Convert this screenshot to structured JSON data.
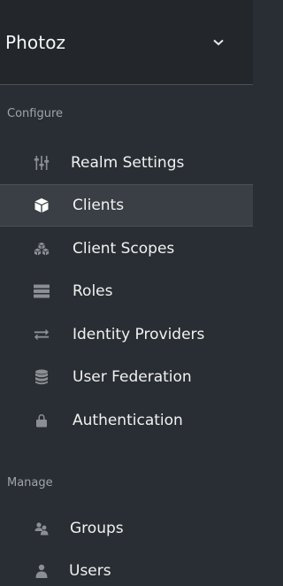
{
  "realm": {
    "name": "Photoz"
  },
  "sections": [
    {
      "header": "Configure",
      "items": [
        {
          "label": "Realm Settings",
          "icon": "sliders-icon"
        },
        {
          "label": "Clients",
          "icon": "cube-icon",
          "active": true
        },
        {
          "label": "Client Scopes",
          "icon": "cubes-icon"
        },
        {
          "label": "Roles",
          "icon": "list-icon"
        },
        {
          "label": "Identity Providers",
          "icon": "exchange-icon"
        },
        {
          "label": "User Federation",
          "icon": "database-icon"
        },
        {
          "label": "Authentication",
          "icon": "lock-icon"
        }
      ]
    },
    {
      "header": "Manage",
      "items": [
        {
          "label": "Groups",
          "icon": "users-icon"
        },
        {
          "label": "Users",
          "icon": "user-icon"
        }
      ]
    }
  ],
  "colors": {
    "sidebar_bg": "#292e34",
    "header_bg": "#23272c",
    "active_bg": "#393f44",
    "icon_color": "#8b8f93",
    "active_icon_color": "#ffffff"
  }
}
